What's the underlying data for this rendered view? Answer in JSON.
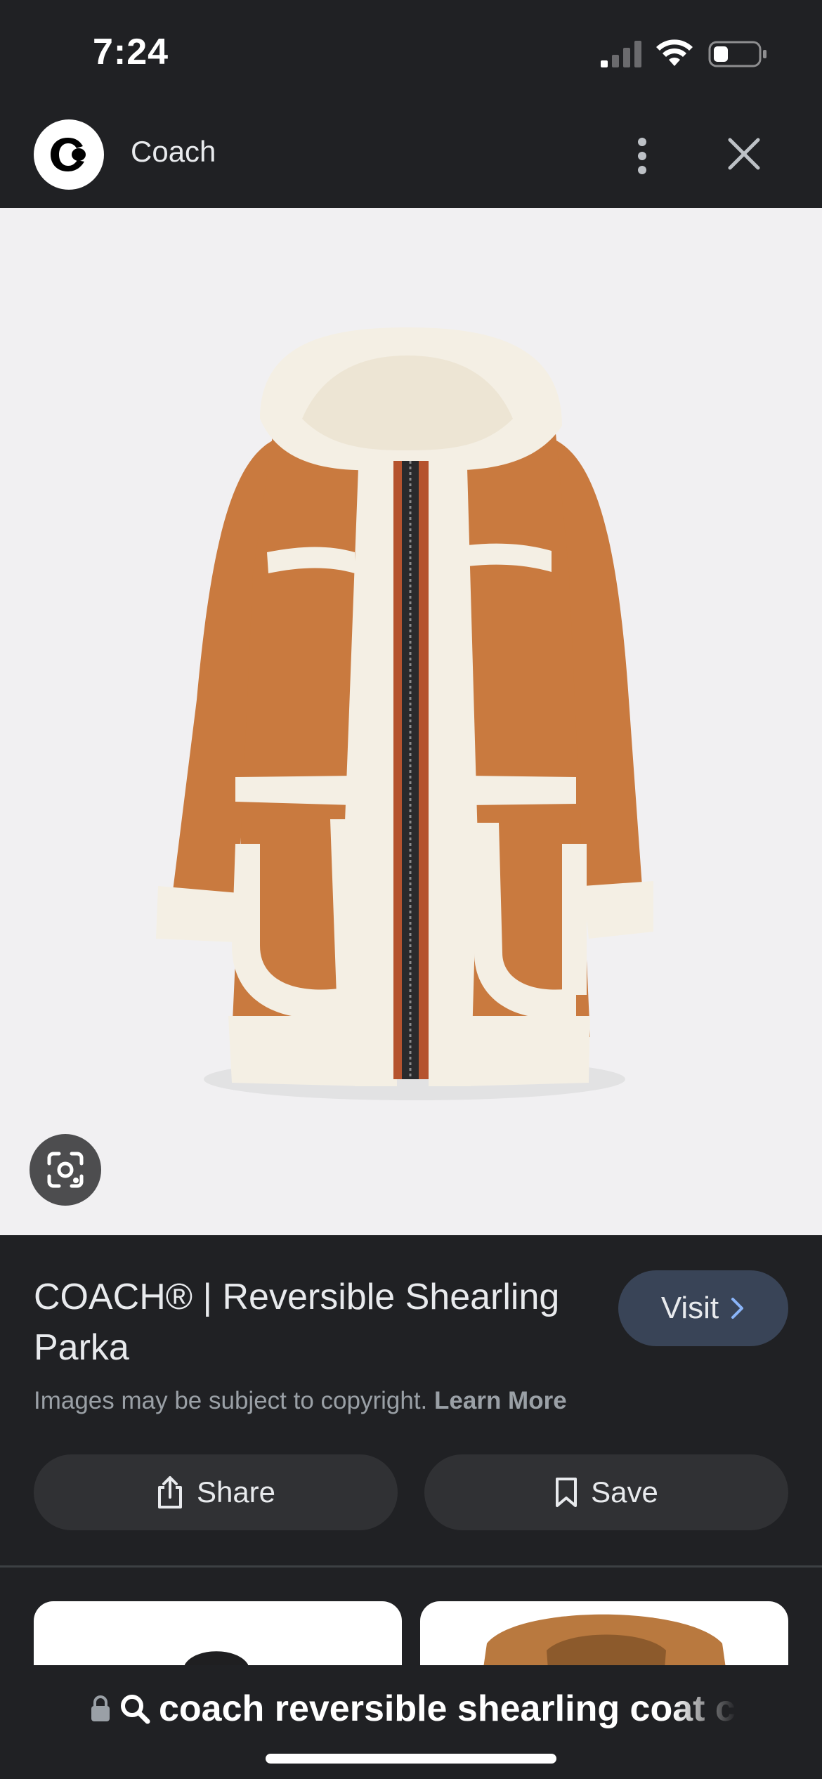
{
  "status_bar": {
    "time": "7:24",
    "signal_icon": "cellular-signal-icon",
    "wifi_icon": "wifi-icon",
    "battery_icon": "battery-icon",
    "battery_level": 0.3
  },
  "header": {
    "site_logo_icon": "coach-logo-icon",
    "site_name": "Coach",
    "more_icon": "more-vertical-icon",
    "close_icon": "close-icon"
  },
  "image": {
    "subject": "coat-image",
    "lens_icon": "google-lens-icon"
  },
  "info": {
    "title": "COACH® | Reversible Shearling Parka",
    "visit_label": "Visit",
    "visit_icon": "chevron-right-icon",
    "copyright_text": "Images may be subject to copyright.",
    "learn_more": "Learn More",
    "share_label": "Share",
    "share_icon": "share-icon",
    "save_label": "Save",
    "save_icon": "bookmark-icon"
  },
  "url_bar": {
    "lock_icon": "lock-icon",
    "search_icon": "search-icon",
    "query": "coach reversible shearling coat c"
  },
  "colors": {
    "background": "#202124",
    "image_background": "#f1f0f2",
    "visit_button": "#394457",
    "action_button": "#303134",
    "coat_tan": "#c97a3f",
    "shearling": "#f4efe4"
  }
}
